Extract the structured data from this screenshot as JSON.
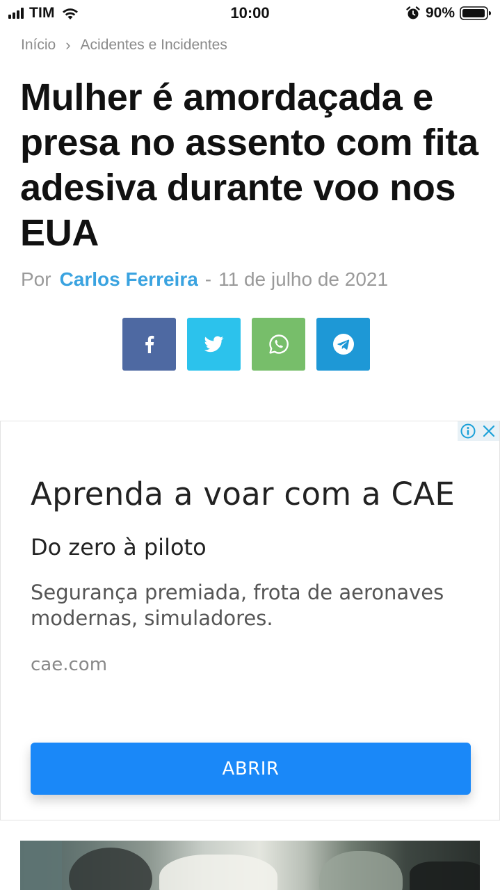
{
  "status_bar": {
    "carrier": "TIM",
    "time": "10:00",
    "battery_percent": "90%"
  },
  "breadcrumb": {
    "home": "Início",
    "separator": "›",
    "category": "Acidentes e Incidentes"
  },
  "article": {
    "title": "Mulher é amordaçada e presa no assento com fita adesiva durante voo nos EUA",
    "byline_prefix": "Por",
    "author": "Carlos Ferreira",
    "dash": "-",
    "date": "11 de julho de 2021"
  },
  "share_buttons": [
    {
      "network": "facebook",
      "icon": "facebook-icon",
      "color": "#4e69a2"
    },
    {
      "network": "twitter",
      "icon": "twitter-icon",
      "color": "#2cc2ec"
    },
    {
      "network": "whatsapp",
      "icon": "whatsapp-icon",
      "color": "#77be6a"
    },
    {
      "network": "telegram",
      "icon": "telegram-icon",
      "color": "#1e98d6"
    }
  ],
  "ad": {
    "title": "Aprenda a voar com a CAE",
    "subtitle": "Do zero à piloto",
    "description": "Segurança premiada, frota de aeronaves modernas, simuladores.",
    "url": "cae.com",
    "cta_label": "ABRIR",
    "info_icon": "info-icon",
    "close_icon": "close-icon"
  },
  "colors": {
    "author_link": "#3aa3e0",
    "cta": "#1a88f8",
    "meta_text": "#9a9a9a"
  }
}
